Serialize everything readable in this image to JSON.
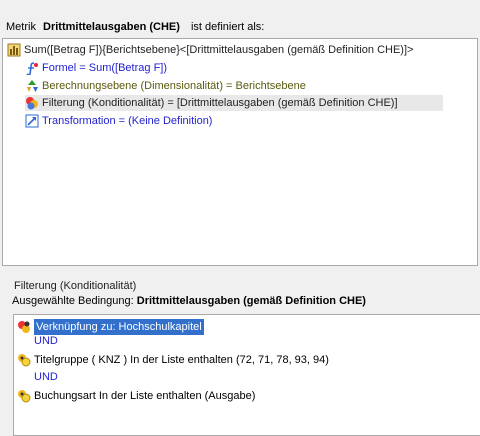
{
  "header": {
    "prefix": "Metrik",
    "metric_name": "Drittmittelausgaben (CHE)",
    "suffix": "ist definiert als:"
  },
  "tree": {
    "root": "Sum([Betrag F]){Berichtsebene}<[Drittmittelausgaben (gemäß Definition CHE)]>",
    "children": [
      {
        "label": "Formel = Sum([Betrag F])",
        "icon": "formula-icon"
      },
      {
        "label": "Berechnungsebene (Dimensionalität) = Berichtsebene",
        "icon": "dimensionality-icon"
      },
      {
        "label": "Filterung (Konditionalität) = [Drittmittelausgaben (gemäß Definition CHE)]",
        "icon": "filter-icon"
      },
      {
        "label": "Transformation = (Keine Definition)",
        "icon": "transformation-icon"
      }
    ]
  },
  "filter_panel": {
    "title": "Filterung (Konditionalität)",
    "condition_prefix": "Ausgewählte Bedingung:",
    "condition_name": "Drittmittelausgaben (gemäß Definition CHE)",
    "rows": [
      {
        "label": "Verknüpfung zu: Hochschulkapitel",
        "icon": "relationship-filter-icon",
        "selected": true
      },
      {
        "connector": "UND"
      },
      {
        "label": "Titelgruppe ( KNZ )  In der Liste enthalten (72,  71, 78, 93, 94)",
        "icon": "attribute-qualification-icon"
      },
      {
        "connector": "UND"
      },
      {
        "label": "Buchungsart In der Liste enthalten (Ausgabe)",
        "icon": "attribute-qualification-icon"
      }
    ]
  },
  "colors": {
    "selection": "#3370cc",
    "link_blue": "#1f1fd0",
    "olive": "#5b5a0f"
  }
}
